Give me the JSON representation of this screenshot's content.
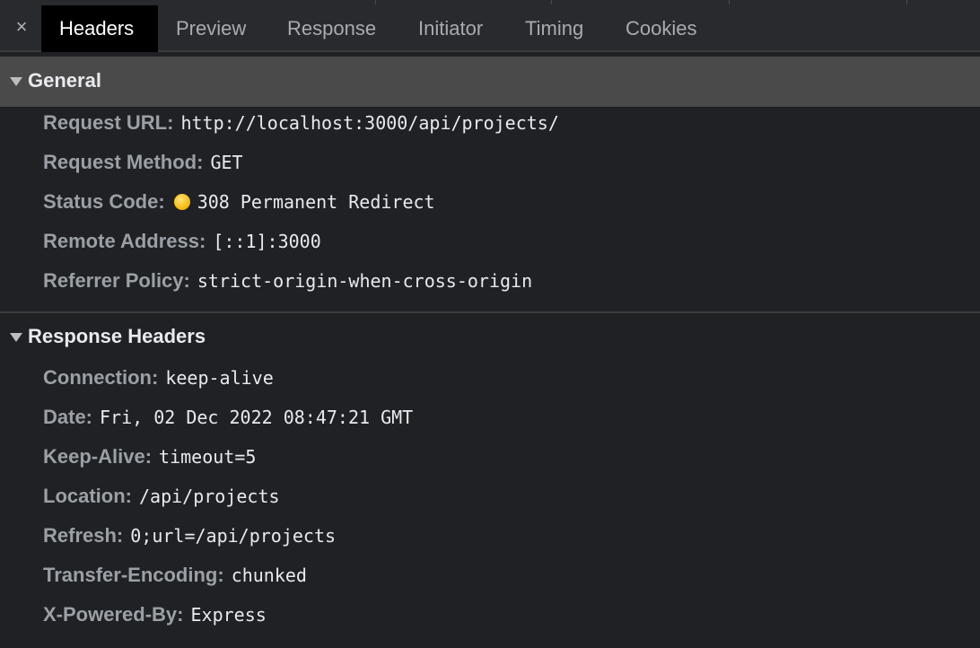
{
  "tabs": [
    {
      "label": "Headers"
    },
    {
      "label": "Preview"
    },
    {
      "label": "Response"
    },
    {
      "label": "Initiator"
    },
    {
      "label": "Timing"
    },
    {
      "label": "Cookies"
    }
  ],
  "active_tab": "Headers",
  "close_icon": "×",
  "general": {
    "title": "General",
    "rows": [
      {
        "name": "Request URL:",
        "value": "http://localhost:3000/api/projects/"
      },
      {
        "name": "Request Method:",
        "value": "GET"
      },
      {
        "name": "Status Code:",
        "value": "308 Permanent Redirect"
      },
      {
        "name": "Remote Address:",
        "value": "[::1]:3000"
      },
      {
        "name": "Referrer Policy:",
        "value": "strict-origin-when-cross-origin"
      }
    ]
  },
  "response_headers": {
    "title": "Response Headers",
    "rows": [
      {
        "name": "Connection:",
        "value": "keep-alive"
      },
      {
        "name": "Date:",
        "value": "Fri, 02 Dec 2022 08:47:21 GMT"
      },
      {
        "name": "Keep-Alive:",
        "value": "timeout=5"
      },
      {
        "name": "Location:",
        "value": "/api/projects"
      },
      {
        "name": "Refresh:",
        "value": "0;url=/api/projects"
      },
      {
        "name": "Transfer-Encoding:",
        "value": "chunked"
      },
      {
        "name": "X-Powered-By:",
        "value": "Express"
      }
    ]
  },
  "colors": {
    "status_dot": "#f2b705",
    "background": "#202124",
    "active_tab": "#000000"
  },
  "icons": {
    "close": "close-icon",
    "collapse": "triangle-down-icon",
    "status": "status-dot-icon"
  }
}
